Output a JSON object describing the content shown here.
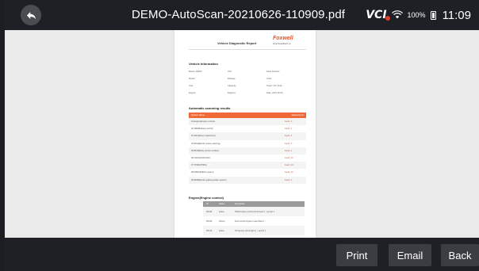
{
  "header": {
    "title": "DEMO-AutoScan-20210626-110909.pdf",
    "vci_label": "VCI",
    "battery": "100%",
    "time": "11:09"
  },
  "report": {
    "title": "Vehicle Diagnostic Report",
    "logo": "Foxwell",
    "logo_url": "www.foxwelltech.us",
    "vehicle_info_heading": "Vehicle Information",
    "info_rows": [
      [
        "Brand: DEMO",
        "VIN:",
        "Fault Position:"
      ],
      [
        "Model:",
        "Mileage:",
        "Color:"
      ],
      [
        "Year:",
        "Capacity:",
        "Tester: Pro Scan"
      ],
      [
        "Engine:",
        "Regions:",
        "Date: 2021.06.26"
      ]
    ],
    "scan_heading": "Automatic scanning results",
    "scan_header": [
      "System Name",
      "Status/Count"
    ],
    "scan_rows": [
      [
        "01 Engine(Engine control)",
        "Fault | 3"
      ],
      [
        "02 ABS(Braking control)",
        "Fault | 2"
      ],
      [
        "03 SRS(Driver crash/restr)",
        "Fault | 4"
      ],
      [
        "04 EPS(Electric power steering)",
        "Fault | 3"
      ],
      [
        "05 BCM(Body control module)",
        "Fault | 2"
      ],
      [
        "06 HVAC(HVAC/A/C)",
        "Fault | 10"
      ],
      [
        "07 TPMS(TPMS)",
        "Fault | 16"
      ],
      [
        "08 IMMO(IMMO system)",
        "Fault | 10"
      ],
      [
        "09 EPB(Electric parking-brake system)",
        "Fault | 3"
      ]
    ],
    "engine_heading": "Engine(Engine control)",
    "dtc_header": [
      "ID",
      "Status",
      "Description"
    ],
    "dtc_rows": [
      [
        "P0030",
        "Active",
        "HO2S heater control circuit bank 1 - sensor 1"
      ],
      [
        "P0036",
        "History",
        "Fuel Control System Lean Bank 1"
      ],
      [
        "P0130",
        "Active",
        "O2 Sensor circuit bank 1 - sensor 1"
      ]
    ]
  },
  "toolbar": {
    "print": "Print",
    "email": "Email",
    "back": "Back"
  },
  "colors": {
    "accent": "#f06a38",
    "topbar": "#1e2025",
    "viewer_bg": "#eaeaea"
  }
}
